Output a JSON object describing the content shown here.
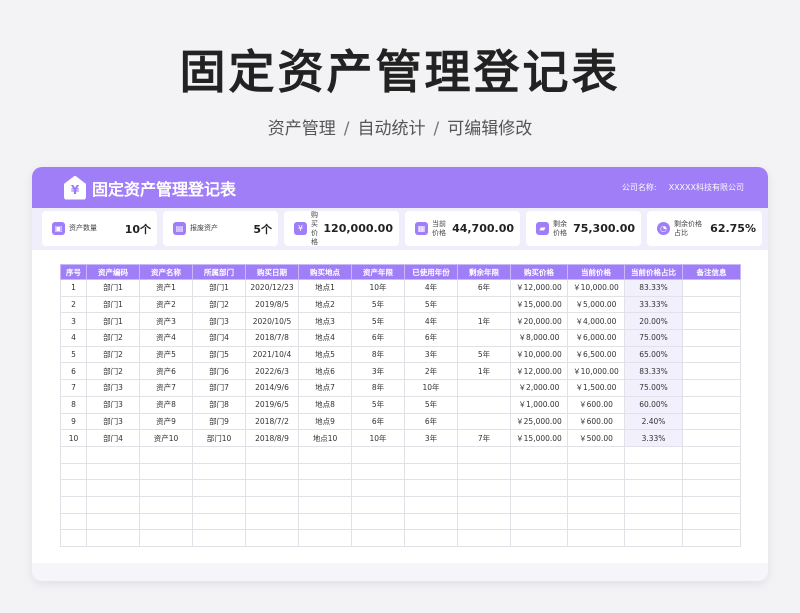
{
  "title": "固定资产管理登记表",
  "subtitle": [
    "资产管理",
    "自动统计",
    "可编辑修改"
  ],
  "subtitle_sep": "/",
  "header": {
    "icon": "¥",
    "title": "固定资产管理登记表",
    "company_label": "公司名称:",
    "company_value": "XXXXX科技有限公司"
  },
  "stats": [
    {
      "icon": "box-icon",
      "label": "资产数量",
      "value": "10个"
    },
    {
      "icon": "scrap-icon",
      "label": "报废资产",
      "value": "5个"
    },
    {
      "icon": "price-tag-icon",
      "label": "购买价格",
      "value": "120,000.00"
    },
    {
      "icon": "current-value-icon",
      "label": "当前价格",
      "value": "44,700.00"
    },
    {
      "icon": "remaining-value-icon",
      "label": "剩余价格",
      "value": "75,300.00"
    },
    {
      "icon": "pie-icon",
      "label": "剩余价格占比",
      "value": "62.75%"
    }
  ],
  "table": {
    "headers": [
      "序号",
      "资产编码",
      "资产名称",
      "所属部门",
      "购买日期",
      "购买地点",
      "资产年限",
      "已使用年份",
      "剩余年限",
      "购买价格",
      "当前价格",
      "当前价格占比",
      "备注信息"
    ],
    "rows": [
      [
        "1",
        "部门1",
        "资产1",
        "部门1",
        "2020/12/23",
        "地点1",
        "10年",
        "4年",
        "6年",
        "￥12,000.00",
        "￥10,000.00",
        "83.33%",
        ""
      ],
      [
        "2",
        "部门1",
        "资产2",
        "部门2",
        "2019/8/5",
        "地点2",
        "5年",
        "5年",
        "",
        "￥15,000.00",
        "￥5,000.00",
        "33.33%",
        ""
      ],
      [
        "3",
        "部门1",
        "资产3",
        "部门3",
        "2020/10/5",
        "地点3",
        "5年",
        "4年",
        "1年",
        "￥20,000.00",
        "￥4,000.00",
        "20.00%",
        ""
      ],
      [
        "4",
        "部门2",
        "资产4",
        "部门4",
        "2018/7/8",
        "地点4",
        "6年",
        "6年",
        "",
        "￥8,000.00",
        "￥6,000.00",
        "75.00%",
        ""
      ],
      [
        "5",
        "部门2",
        "资产5",
        "部门5",
        "2021/10/4",
        "地点5",
        "8年",
        "3年",
        "5年",
        "￥10,000.00",
        "￥6,500.00",
        "65.00%",
        ""
      ],
      [
        "6",
        "部门2",
        "资产6",
        "部门6",
        "2022/6/3",
        "地点6",
        "3年",
        "2年",
        "1年",
        "￥12,000.00",
        "￥10,000.00",
        "83.33%",
        ""
      ],
      [
        "7",
        "部门3",
        "资产7",
        "部门7",
        "2014/9/6",
        "地点7",
        "8年",
        "10年",
        "",
        "￥2,000.00",
        "￥1,500.00",
        "75.00%",
        ""
      ],
      [
        "8",
        "部门3",
        "资产8",
        "部门8",
        "2019/6/5",
        "地点8",
        "5年",
        "5年",
        "",
        "￥1,000.00",
        "￥600.00",
        "60.00%",
        ""
      ],
      [
        "9",
        "部门3",
        "资产9",
        "部门9",
        "2018/7/2",
        "地点9",
        "6年",
        "6年",
        "",
        "￥25,000.00",
        "￥600.00",
        "2.40%",
        ""
      ],
      [
        "10",
        "部门4",
        "资产10",
        "部门10",
        "2018/8/9",
        "地点10",
        "10年",
        "3年",
        "7年",
        "￥15,000.00",
        "￥500.00",
        "3.33%",
        ""
      ]
    ],
    "empty_rows": 6
  }
}
